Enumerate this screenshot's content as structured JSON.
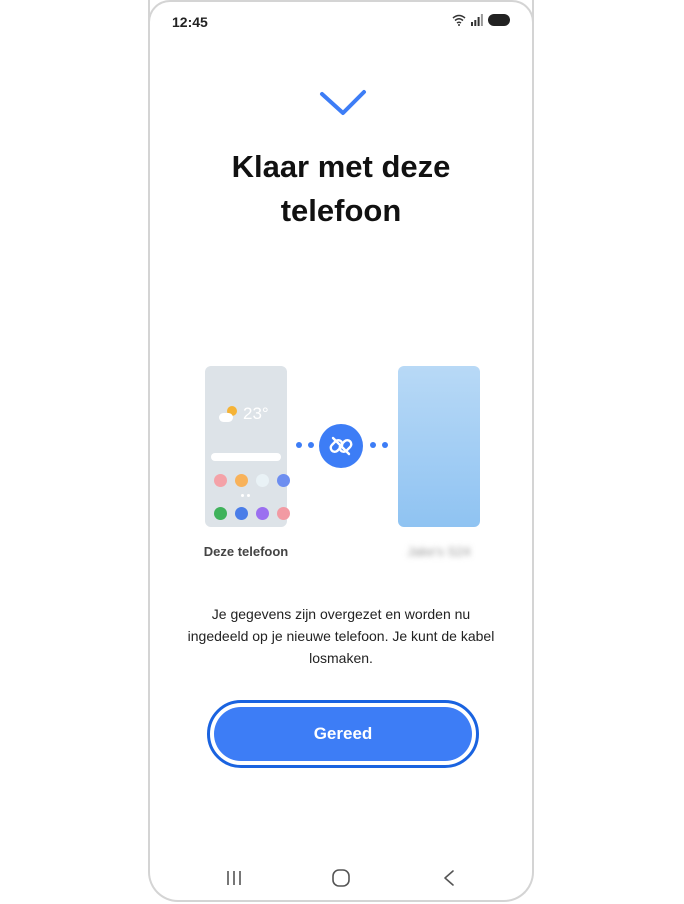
{
  "status_bar": {
    "time": "12:45"
  },
  "title": "Klaar met deze telefoon",
  "illustration": {
    "old_phone_temp": "23°",
    "old_phone_label": "Deze telefoon",
    "new_phone_label": "Jake's S24",
    "app_colors_row1": [
      "#f4a2a8",
      "#f8b25a",
      "#e9f2f6",
      "#6d8ef0"
    ],
    "app_colors_row2": [
      "#3fb25b",
      "#4a7de8",
      "#9b6ff0",
      "#f29aa3"
    ]
  },
  "description": "Je gegevens zijn overgezet en worden nu ingedeeld op je nieuwe telefoon. Je kunt de kabel losmaken.",
  "done_button": {
    "label": "Gereed"
  },
  "colors": {
    "accent": "#3d7df6",
    "focus_ring": "#1a63e0"
  },
  "nav_bar": {
    "icons": [
      "recent-apps-icon",
      "home-icon",
      "back-icon"
    ]
  }
}
